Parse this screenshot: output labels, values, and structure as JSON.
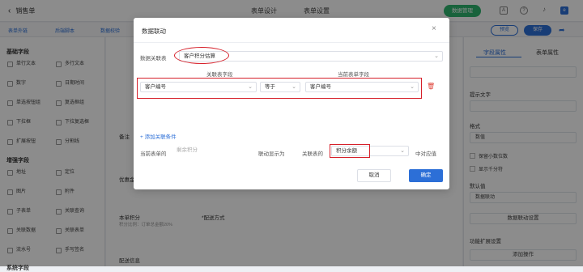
{
  "header": {
    "back_label": "销售单",
    "tabs": [
      "表单设计",
      "表单设置"
    ],
    "manage_label": "数据管理"
  },
  "toolbar": {
    "items": [
      "表单外链",
      "后端脚本",
      "数据校验"
    ],
    "preview_label": "预览",
    "save_label": "保存"
  },
  "sidebar": {
    "basic_title": "基础字段",
    "basic_fields": [
      "单行文本",
      "多行文本",
      "数字",
      "日期时间",
      "单选按钮组",
      "复选框组",
      "下拉框",
      "下拉复选框",
      "扩展按钮",
      "分割线"
    ],
    "advanced_title": "增强字段",
    "advanced_fields": [
      "地址",
      "定位",
      "图片",
      "附件",
      "子表单",
      "关联查询",
      "关联数据",
      "关联表单",
      "流水号",
      "手写签名"
    ],
    "system_title": "系统字段"
  },
  "canvas": {
    "labels": [
      "备注",
      "优惠金额",
      "本单积分",
      "*配送方式",
      "配送信息"
    ],
    "points_hint": "积分比例：订单总金额20%"
  },
  "right_panel": {
    "tabs": [
      "字段属性",
      "表单属性"
    ],
    "hint_label": "提示文字",
    "format_label": "格式",
    "format_value": "数值",
    "keep_decimal": "保留小数位数",
    "thousands": "显示千分符",
    "default_label": "默认值",
    "default_value": "数据联动",
    "linkage_button": "数据联动设置",
    "extend_label": "功能扩展设置",
    "add_action": "添加操作"
  },
  "dialog": {
    "title": "数据联动",
    "table_label": "数据关联表",
    "table_value": "客户积分估算",
    "col_related": "关联表字段",
    "col_current": "当前表单字段",
    "cond_field": "客户编号",
    "cond_op": "等于",
    "cond_current": "客户编号",
    "add_condition": "+ 添加关联条件",
    "display_prefix": "当前表单的",
    "display_field": "剩余积分",
    "display_mid": "联动显示为",
    "display_related_prefix": "关联表的",
    "display_related_field": "积分余额",
    "display_suffix": "中对应值",
    "cancel_label": "取消",
    "ok_label": "确定"
  },
  "colors": {
    "accent": "#2c6fd7",
    "green": "#2fb46e",
    "annotation_red": "#d6202a"
  }
}
